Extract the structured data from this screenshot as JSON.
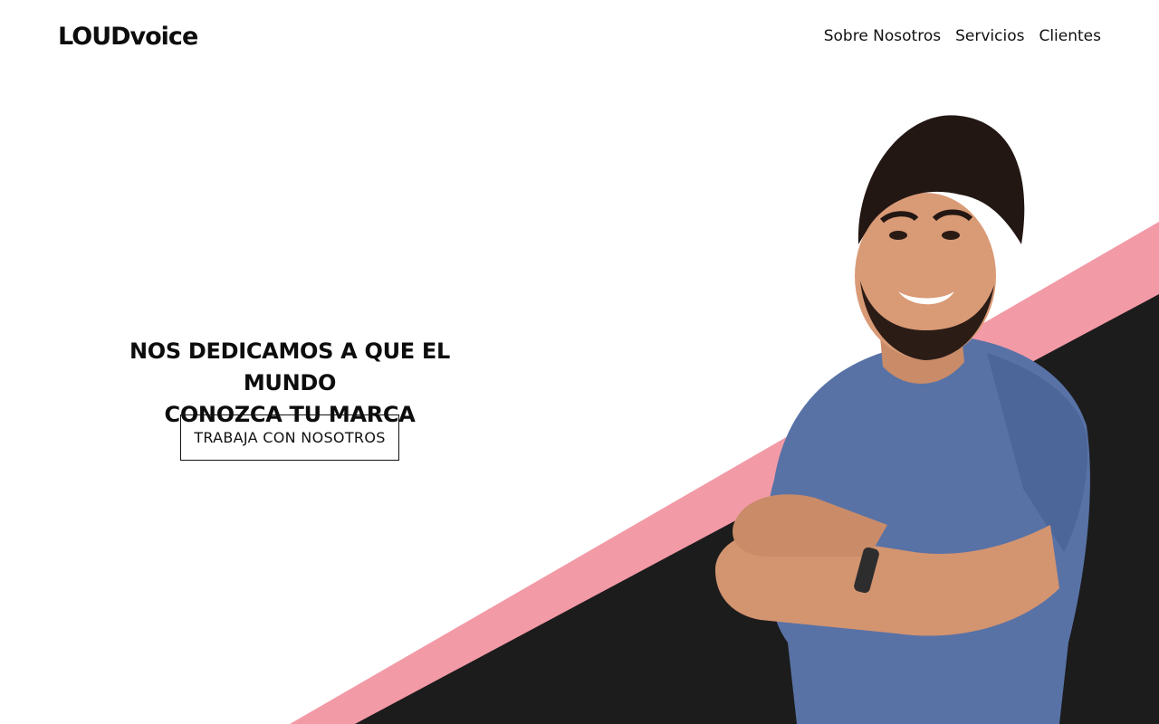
{
  "brand": {
    "logo_text": "LOUDvoice"
  },
  "nav": {
    "items": [
      {
        "label": "Sobre Nosotros"
      },
      {
        "label": "Servicios"
      },
      {
        "label": "Clientes"
      }
    ]
  },
  "hero": {
    "title_line1": "NOS DEDICAMOS A QUE EL MUNDO",
    "title_line2": "CONOZCA TU MARCA",
    "cta_label": "TRABAJA CON NOSOTROS"
  },
  "colors": {
    "background": "#ffffff",
    "accent_pink": "#f39aa7",
    "dark_band": "#1c1c1c",
    "text": "#111111",
    "shirt": "#5872a6"
  },
  "icons": {
    "person_image": "smiling-man-crossed-arms-photo"
  }
}
